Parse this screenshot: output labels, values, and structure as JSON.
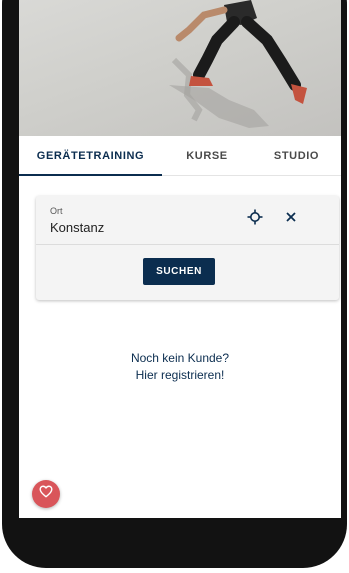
{
  "tabs": [
    {
      "label": "GERÄTETRAINING",
      "active": true
    },
    {
      "label": "KURSE",
      "active": false
    },
    {
      "label": "STUDIO",
      "active": false
    }
  ],
  "search_card": {
    "location_label": "Ort",
    "location_value": "Konstanz",
    "search_button": "SUCHEN"
  },
  "register": {
    "line1": "Noch kein Kunde?",
    "line2": "Hier registrieren!"
  },
  "icons": {
    "locate": "crosshair-icon",
    "clear": "close-icon",
    "favorite": "heart-icon"
  },
  "colors": {
    "primary": "#0b2d4f",
    "favorite": "#d9555a"
  }
}
